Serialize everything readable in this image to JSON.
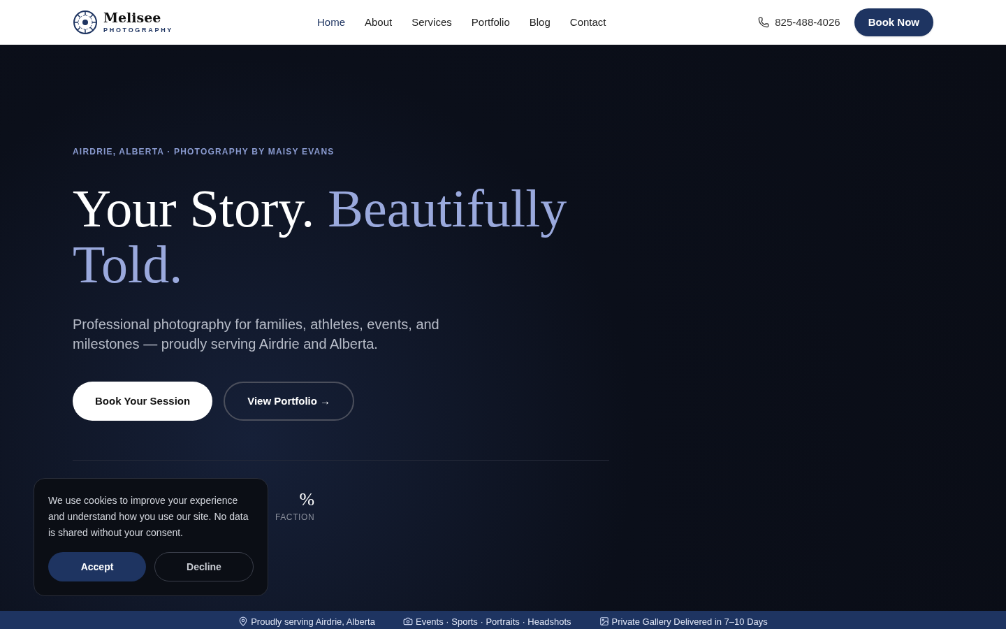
{
  "brand": {
    "name": "Melisee",
    "tagline": "PHOTOGRAPHY"
  },
  "nav": [
    {
      "label": "Home",
      "selected": true
    },
    {
      "label": "About",
      "selected": false
    },
    {
      "label": "Services",
      "selected": false
    },
    {
      "label": "Portfolio",
      "selected": false
    },
    {
      "label": "Blog",
      "selected": false
    },
    {
      "label": "Contact",
      "selected": false
    }
  ],
  "phone": "825-488-4026",
  "book_button": "Book Now",
  "hero": {
    "eyebrow": "AIRDRIE, ALBERTA · PHOTOGRAPHY BY MAISY EVANS",
    "title_plain": "Your Story.",
    "title_accent": "Beautifully Told.",
    "subtitle": "Professional photography for families, athletes, events, and milestones — proudly serving Airdrie and Alberta.",
    "primary_button": "Book Your Session",
    "secondary_button": "View Portfolio →"
  },
  "stats": [
    {
      "value": "%",
      "label": "FACTION"
    }
  ],
  "cookie": {
    "text": "We use cookies to improve your experience and understand how you use our site. No data is shared without your consent.",
    "accept": "Accept",
    "decline": "Decline"
  },
  "strip": [
    {
      "kind": "pin",
      "text": "Proudly serving Airdrie, Alberta"
    },
    {
      "kind": "camera",
      "text": "Events · Sports · Portraits · Headshots"
    },
    {
      "kind": "picture",
      "text": "Private Gallery Delivered in 7–10 Days"
    }
  ]
}
